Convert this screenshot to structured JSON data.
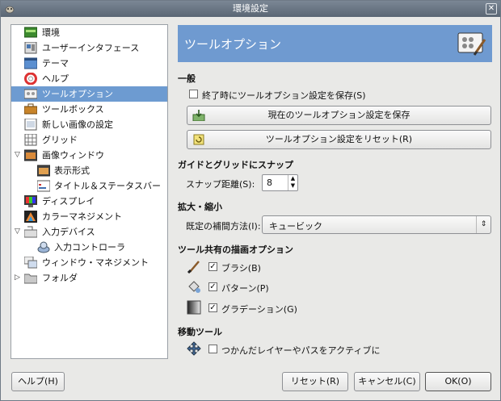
{
  "window": {
    "title": "環境設定",
    "close_glyph": "✕"
  },
  "tree": [
    {
      "label": "環境",
      "icon": "environment-icon",
      "level": 0
    },
    {
      "label": "ユーザーインタフェース",
      "icon": "user-interface-icon",
      "level": 0
    },
    {
      "label": "テーマ",
      "icon": "theme-icon",
      "level": 0
    },
    {
      "label": "ヘルプ",
      "icon": "help-lifebuoy-icon",
      "level": 0
    },
    {
      "label": "ツールオプション",
      "icon": "tool-options-icon",
      "level": 0,
      "selected": true
    },
    {
      "label": "ツールボックス",
      "icon": "toolbox-icon",
      "level": 0
    },
    {
      "label": "新しい画像の設定",
      "icon": "new-image-icon",
      "level": 0
    },
    {
      "label": "グリッド",
      "icon": "grid-icon",
      "level": 0
    },
    {
      "label": "画像ウィンドウ",
      "icon": "image-window-icon",
      "level": 0,
      "expander": "▽"
    },
    {
      "label": "表示形式",
      "icon": "appearance-icon",
      "level": 1
    },
    {
      "label": "タイトル＆ステータスバー",
      "icon": "title-status-icon",
      "level": 1
    },
    {
      "label": "ディスプレイ",
      "icon": "display-icon",
      "level": 0
    },
    {
      "label": "カラーマネジメント",
      "icon": "color-management-icon",
      "level": 0
    },
    {
      "label": "入力デバイス",
      "icon": "input-devices-icon",
      "level": 0,
      "expander": "▽"
    },
    {
      "label": "入力コントローラ",
      "icon": "input-controllers-icon",
      "level": 1
    },
    {
      "label": "ウィンドウ・マネジメント",
      "icon": "window-management-icon",
      "level": 0
    },
    {
      "label": "フォルダ",
      "icon": "folder-icon",
      "level": 0,
      "expander": "▷"
    }
  ],
  "panel": {
    "title": "ツールオプション",
    "general": {
      "heading": "一般",
      "save_on_exit": {
        "label": "終了時にツールオプション設定を保存(S)",
        "checked": false
      },
      "save_now_button": "現在のツールオプション設定を保存",
      "reset_button": "ツールオプション設定をリセット(R)"
    },
    "snap": {
      "heading": "ガイドとグリッドにスナップ",
      "distance_label": "スナップ距離(S):",
      "distance_value": "8"
    },
    "scale": {
      "heading": "拡大・縮小",
      "interp_label": "既定の補間方法(I):",
      "interp_value": "キュービック"
    },
    "paint": {
      "heading": "ツール共有の描画オプション",
      "brush": {
        "label": "ブラシ(B)",
        "checked": true
      },
      "pattern": {
        "label": "パターン(P)",
        "checked": true
      },
      "gradient": {
        "label": "グラデーション(G)",
        "checked": true
      }
    },
    "move": {
      "heading": "移動ツール",
      "activate": {
        "label": "つかんだレイヤーやパスをアクティブに",
        "checked": false
      }
    }
  },
  "footer": {
    "help": "ヘルプ(H)",
    "reset": "リセット(R)",
    "cancel": "キャンセル(C)",
    "ok": "OK(O)"
  },
  "check_glyph": "✓"
}
